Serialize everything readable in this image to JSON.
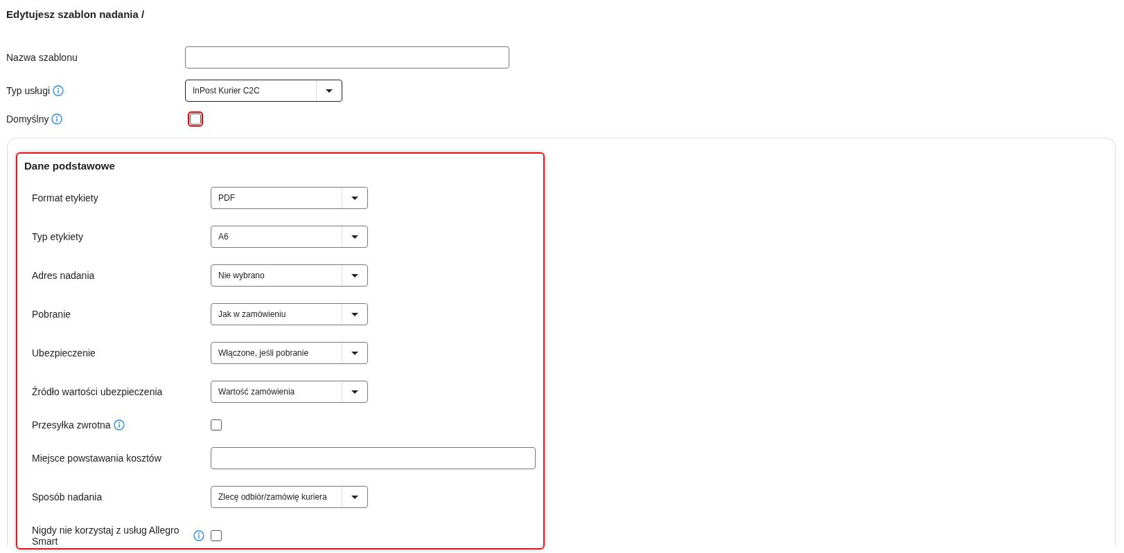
{
  "page": {
    "title": "Edytujesz szablon nadania /"
  },
  "fields": [
    {
      "kind": "text",
      "label": "Nazwa szablonu",
      "info": false
    },
    {
      "kind": "select",
      "label": "Typ usługi",
      "info": true,
      "value": "InPost Kurier C2C"
    },
    {
      "kind": "checkbox",
      "label": "Domyślny",
      "info": true,
      "checked": false,
      "highlighted": true
    }
  ],
  "section": {
    "title": "Dane podstawowe",
    "highlighted": true,
    "fields": [
      {
        "kind": "select",
        "label": "Format etykiety",
        "info": false,
        "value": "PDF"
      },
      {
        "kind": "select",
        "label": "Typ etykiety",
        "info": false,
        "value": "A6"
      },
      {
        "kind": "select",
        "label": "Adres nadania",
        "info": false,
        "value": "Nie wybrano"
      },
      {
        "kind": "select",
        "label": "Pobranie",
        "info": false,
        "value": "Jak w zamówieniu"
      },
      {
        "kind": "select",
        "label": "Ubezpieczenie",
        "info": false,
        "value": "Włączone, jeśli pobranie"
      },
      {
        "kind": "select",
        "label": "Źródło wartości ubezpieczenia",
        "info": false,
        "value": "Wartość zamówienia"
      },
      {
        "kind": "checkbox",
        "label": "Przesyłka zwrotna",
        "info": true,
        "checked": false,
        "highlighted": false
      },
      {
        "kind": "text",
        "label": "Miejsce powstawania kosztów",
        "info": false
      },
      {
        "kind": "select",
        "label": "Sposób nadania",
        "info": false,
        "value": "Zlecę odbiór/zamówię kuriera"
      },
      {
        "kind": "checkbox",
        "label": "Nigdy nie korzystaj z usług Allegro Smart",
        "info": true,
        "checked": false,
        "highlighted": false
      }
    ]
  }
}
